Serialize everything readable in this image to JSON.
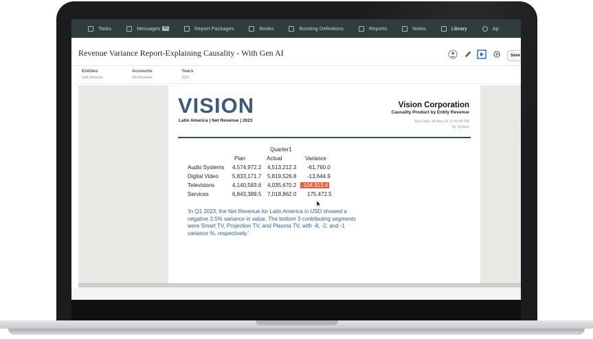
{
  "nav": {
    "items": [
      {
        "label": "Tasks",
        "icon": "tasks-icon"
      },
      {
        "label": "Messages",
        "icon": "messages-icon",
        "badge": "88"
      },
      {
        "label": "Report Packages",
        "icon": "report-packages-icon"
      },
      {
        "label": "Books",
        "icon": "books-icon"
      },
      {
        "label": "Bursting Definitions",
        "icon": "bursting-icon"
      },
      {
        "label": "Reports",
        "icon": "reports-icon"
      },
      {
        "label": "Notes",
        "icon": "notes-icon"
      },
      {
        "label": "Library",
        "icon": "library-icon",
        "active": true
      },
      {
        "label": "Ap",
        "icon": "gear-icon"
      }
    ]
  },
  "header": {
    "title": "Revenue Variance Report-Explaining Causality - With Gen AI",
    "save_label": "Save"
  },
  "pov": {
    "entities_label": "Entities",
    "entities_value": "Latin America",
    "accounts_label": "Accounts",
    "accounts_value": "Net Revenue",
    "years_label": "Years",
    "years_value": "2023"
  },
  "report": {
    "logo_text": "VISION",
    "logo_subtitle": "Latin America | Net Revenue | 2023",
    "company": "Vision Corporation",
    "report_subtitle": "Causality Product by Entity Revenue",
    "run_date": "Run Date: 08-Mar-24 12:45:49 PM",
    "run_by": "By System",
    "quarter": "Quarter1",
    "columns": [
      "Plan",
      "Actual",
      "Variance"
    ],
    "rows": [
      {
        "name": "Audio Systems",
        "plan": "4,574,972.2",
        "actual": "4,513,212.3",
        "variance": "-61,760.0"
      },
      {
        "name": "Digital Video",
        "plan": "5,833,171.7",
        "actual": "5,819,526.8",
        "variance": "-13,644.9"
      },
      {
        "name": "Televisions",
        "plan": "4,140,583.6",
        "actual": "4,035,670.2",
        "variance": "-104,913.4",
        "highlight": true
      },
      {
        "name": "Services",
        "plan": "6,843,389.5",
        "actual": "7,018,862.0",
        "variance": "175,472.5"
      }
    ],
    "insight": "'In Q1 2023, the Net Revenue for Latin America in USD showed a negative 2.5% variance in value. The bottom 3 contributing segments were Smart TV, Projection TV, and Plasma TV, with -8, -2, and -1 variance %, respectively.'"
  },
  "colors": {
    "nav_bg": "#2f3d3d",
    "logo": "#3a5b7b",
    "insight_text": "#2d5d9a",
    "highlight": "#ea5a3c"
  }
}
